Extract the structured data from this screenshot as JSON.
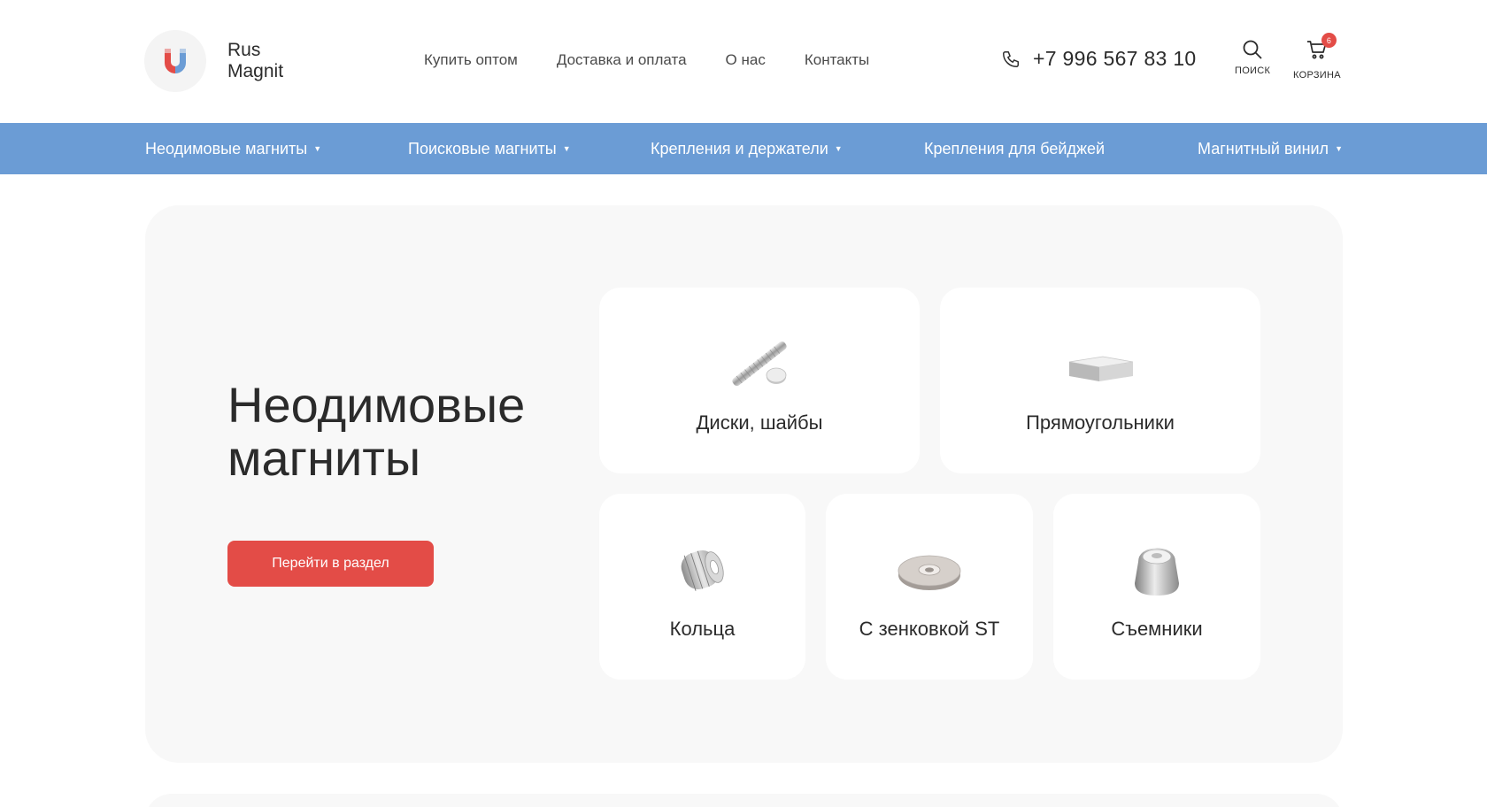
{
  "header": {
    "logo": {
      "line1": "Rus",
      "line2": "Magnit",
      "icon": "magnet-icon",
      "colors": {
        "left": "#e34c47",
        "right": "#6b9cd5"
      }
    },
    "nav": [
      {
        "label": "Купить оптом"
      },
      {
        "label": "Доставка и оплата"
      },
      {
        "label": "О нас"
      },
      {
        "label": "Контакты"
      }
    ],
    "phone": {
      "icon": "phone-icon",
      "number": "+7 996 567 83 10"
    },
    "search": {
      "icon": "search-icon",
      "label": "поиск"
    },
    "cart": {
      "icon": "cart-icon",
      "label": "корзина",
      "count": "6"
    }
  },
  "categories": [
    {
      "label": "Неодимовые магниты",
      "has_dropdown": true
    },
    {
      "label": "Поисковые магниты",
      "has_dropdown": true
    },
    {
      "label": "Крепления и держатели",
      "has_dropdown": true
    },
    {
      "label": "Крепления для бейджей",
      "has_dropdown": false
    },
    {
      "label": "Магнитный винил",
      "has_dropdown": true
    }
  ],
  "section": {
    "title_line1": "Неодимовые",
    "title_line2": "магниты",
    "button_label": "Перейти в раздел",
    "cards": [
      {
        "name": "Диски, шайбы",
        "icon": "disc-magnet-icon"
      },
      {
        "name": "Прямоугольники",
        "icon": "block-magnet-icon"
      },
      {
        "name": "Кольца",
        "icon": "ring-magnet-icon"
      },
      {
        "name": "С зенковкой ST",
        "icon": "countersunk-magnet-icon"
      },
      {
        "name": "Съемники",
        "icon": "pot-magnet-icon"
      }
    ]
  },
  "colors": {
    "accent_red": "#e34c47",
    "accent_blue": "#6b9cd5",
    "panel_bg": "#f8f8f8"
  }
}
